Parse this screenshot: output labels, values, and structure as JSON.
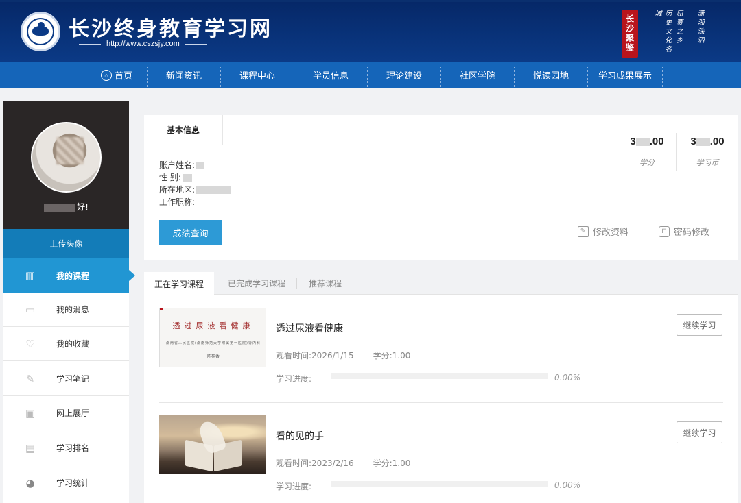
{
  "header": {
    "site_title": "长沙终身教育学习网",
    "site_url": "http://www.cszsjy.com",
    "seal_text": "长沙聚鉴",
    "poem_lines": [
      "历史文化名城",
      "屈贾之乡",
      "潇湘洙泗"
    ]
  },
  "nav": {
    "items": [
      "首页",
      "新闻资讯",
      "课程中心",
      "学员信息",
      "理论建设",
      "社区学院",
      "悦读园地",
      "学习成果展示"
    ]
  },
  "sidebar": {
    "greeting_suffix": "好!",
    "upload_label": "上传头像",
    "items": [
      {
        "label": "我的课程",
        "icon": "books-icon"
      },
      {
        "label": "我的消息",
        "icon": "message-icon"
      },
      {
        "label": "我的收藏",
        "icon": "heart-icon"
      },
      {
        "label": "学习笔记",
        "icon": "note-icon"
      },
      {
        "label": "网上展厅",
        "icon": "gallery-icon"
      },
      {
        "label": "学习排名",
        "icon": "ranking-icon"
      },
      {
        "label": "学习统计",
        "icon": "pie-chart-icon"
      }
    ]
  },
  "info": {
    "tab_label": "基本信息",
    "fields": {
      "account_name_label": "账户姓名:",
      "gender_label": "性 别:",
      "region_label": "所在地区:",
      "job_title_label": "工作职称:"
    },
    "score_button": "成绩查询",
    "credits": {
      "prefix": "3",
      "suffix": ".00",
      "label": "学分"
    },
    "coins": {
      "prefix": "3",
      "suffix": ".00",
      "label": "学习币"
    },
    "edit_profile": "修改资料",
    "change_password": "密码修改"
  },
  "courses": {
    "tabs": [
      "正在学习课程",
      "已完成学习课程",
      "推荐课程"
    ],
    "list": [
      {
        "title": "透过尿液看健康",
        "watch_label": "观看时间:",
        "watch_time": "2026/1/15",
        "credit_label": "学分:",
        "credit": "1.00",
        "progress_label": "学习进度:",
        "progress_pct": "0.00%",
        "progress_value": 0,
        "continue_label": "继续学习",
        "thumb_title": "透过尿液看健康",
        "thumb_sub": "湖南省人民医院(湖南师范大学附属第一医院)肾内科",
        "thumb_author": "陈桂香"
      },
      {
        "title": "看的见的手",
        "watch_label": "观看时间:",
        "watch_time": "2023/2/16",
        "credit_label": "学分:",
        "credit": "1.00",
        "progress_label": "学习进度:",
        "progress_pct": "0.00%",
        "progress_value": 0,
        "continue_label": "继续学习"
      }
    ]
  }
}
